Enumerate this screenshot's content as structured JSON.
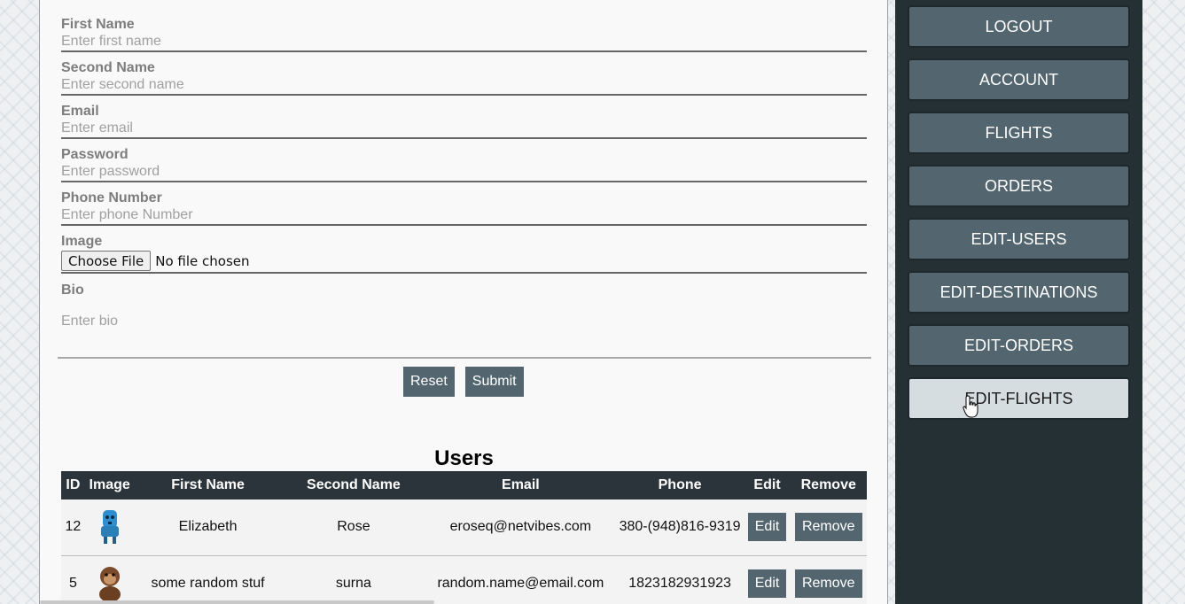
{
  "form": {
    "first_name": {
      "label": "First Name",
      "placeholder": "Enter first name"
    },
    "second_name": {
      "label": "Second Name",
      "placeholder": "Enter second name"
    },
    "email": {
      "label": "Email",
      "placeholder": "Enter email"
    },
    "password": {
      "label": "Password",
      "placeholder": "Enter password"
    },
    "phone": {
      "label": "Phone Number",
      "placeholder": "Enter phone Number"
    },
    "image": {
      "label": "Image",
      "button_label": "Choose File",
      "status": "No file chosen"
    },
    "bio": {
      "label": "Bio",
      "placeholder": "Enter bio"
    },
    "reset_label": "Reset",
    "submit_label": "Submit"
  },
  "users": {
    "title": "Users",
    "columns": [
      "ID",
      "Image",
      "First Name",
      "Second Name",
      "Email",
      "Phone",
      "Edit",
      "Remove"
    ],
    "rows": [
      {
        "id": "12",
        "avatar": "blue-robot-avatar",
        "first_name": "Elizabeth",
        "second_name": "Rose",
        "email": "eroseq@netvibes.com",
        "phone": "380-(948)816-9319",
        "edit_label": "Edit",
        "remove_label": "Remove"
      },
      {
        "id": "5",
        "avatar": "brown-monkey-avatar",
        "first_name": "some random stuf",
        "second_name": "surna",
        "email": "random.name@email.com",
        "phone": "1823182931923",
        "edit_label": "Edit",
        "remove_label": "Remove"
      }
    ]
  },
  "sidebar": {
    "items": [
      {
        "label": "LOGOUT"
      },
      {
        "label": "ACCOUNT"
      },
      {
        "label": "FLIGHTS"
      },
      {
        "label": "ORDERS"
      },
      {
        "label": "EDIT-USERS"
      },
      {
        "label": "EDIT-DESTINATIONS"
      },
      {
        "label": "EDIT-ORDERS"
      },
      {
        "label": "EDIT-FLIGHTS",
        "hovered": true
      }
    ]
  },
  "colors": {
    "button": "#53666f",
    "sidebar_bg": "#253035",
    "table_header": "#2a343a",
    "hovered_nav": "#d5dde0"
  }
}
